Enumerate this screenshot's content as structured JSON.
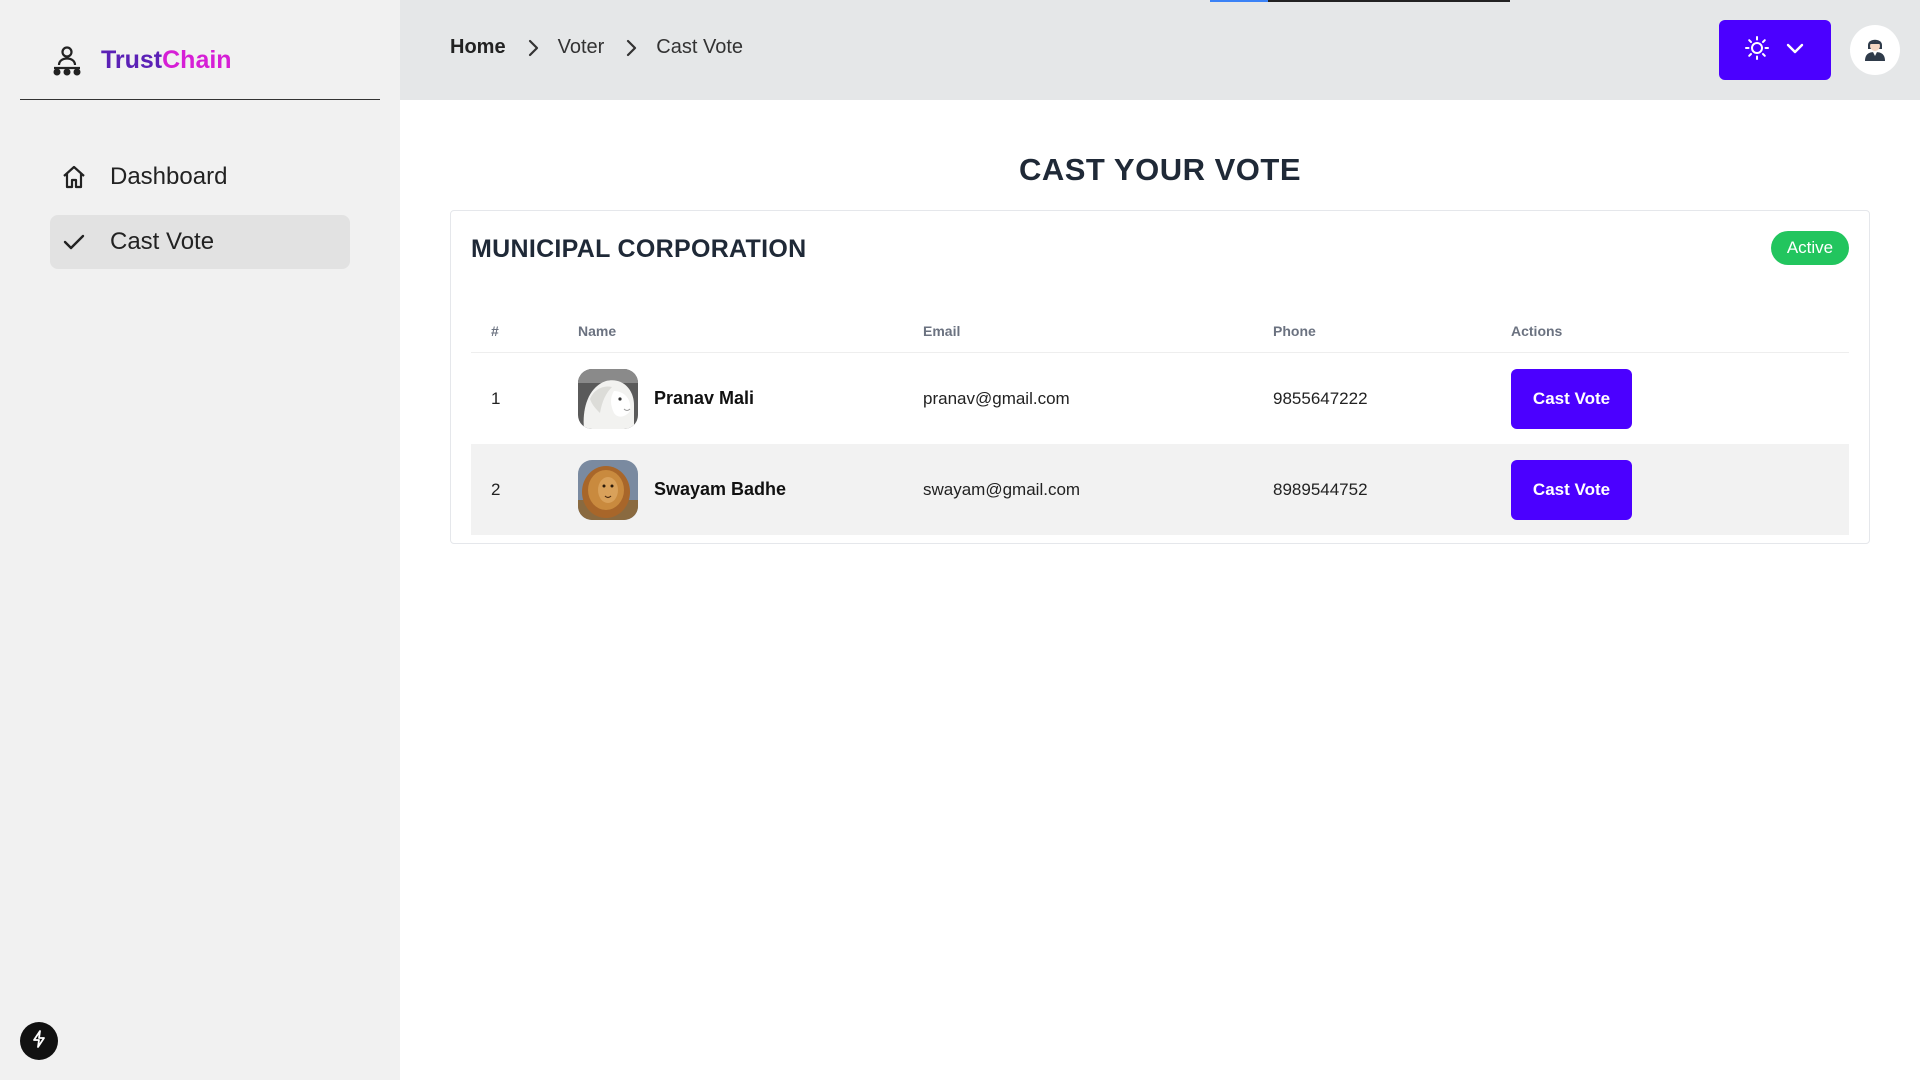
{
  "brand": {
    "part1": "Trust",
    "part2": "Chain",
    "icon": "user-network-icon"
  },
  "sidebar": {
    "items": [
      {
        "label": "Dashboard",
        "icon": "home-icon",
        "active": false
      },
      {
        "label": "Cast Vote",
        "icon": "check-icon",
        "active": true
      }
    ]
  },
  "breadcrumb": {
    "home": "Home",
    "voter": "Voter",
    "current": "Cast Vote"
  },
  "header": {
    "theme_icon": "sun-icon",
    "dropdown_icon": "chevron-down-icon",
    "avatar_icon": "user-avatar-icon"
  },
  "page": {
    "title": "CAST YOUR VOTE"
  },
  "election": {
    "title": "MUNICIPAL CORPORATION",
    "status": "Active",
    "columns": [
      "#",
      "Name",
      "Email",
      "Phone",
      "Actions"
    ],
    "candidates": [
      {
        "index": "1",
        "name": "Pranav Mali",
        "email": "pranav@gmail.com",
        "phone": "9855647222",
        "action": "Cast Vote",
        "photo": "white-lion-photo"
      },
      {
        "index": "2",
        "name": "Swayam Badhe",
        "email": "swayam@gmail.com",
        "phone": "8989544752",
        "action": "Cast Vote",
        "photo": "lion-photo"
      }
    ]
  },
  "colors": {
    "accent": "#4b00ff",
    "brand_primary": "#5b21b6",
    "brand_secondary": "#d61fd6",
    "status_active": "#22c55e"
  }
}
